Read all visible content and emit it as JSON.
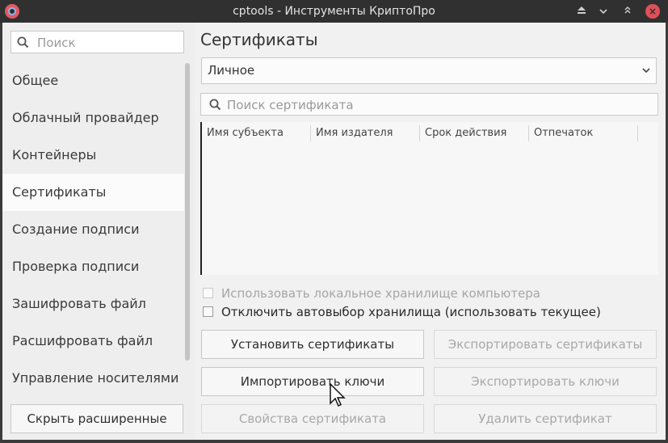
{
  "window": {
    "title": "cptools - Инструменты КриптоПро"
  },
  "sidebar": {
    "search_placeholder": "Поиск",
    "items": [
      {
        "label": "Общее"
      },
      {
        "label": "Облачный провайдер"
      },
      {
        "label": "Контейнеры"
      },
      {
        "label": "Сертификаты",
        "active": true
      },
      {
        "label": "Создание подписи"
      },
      {
        "label": "Проверка подписи"
      },
      {
        "label": "Зашифровать файл"
      },
      {
        "label": "Расшифровать файл"
      },
      {
        "label": "Управление носителями"
      }
    ],
    "hide_button": "Скрыть расширенные"
  },
  "main": {
    "heading": "Сертификаты",
    "store_select": {
      "value": "Личное"
    },
    "search_placeholder": "Поиск сертификата",
    "table": {
      "columns": [
        "Имя субъекта",
        "Имя издателя",
        "Срок действия",
        "Отпечаток"
      ],
      "rows": []
    },
    "options": {
      "use_local_store": {
        "label": "Использовать локальное хранилище компьютера",
        "checked": false,
        "enabled": false
      },
      "disable_autoselect": {
        "label": "Отключить автовыбор хранилища (использовать текущее)",
        "checked": false,
        "enabled": true
      }
    },
    "buttons": {
      "install_certs": {
        "label": "Установить сертификаты",
        "enabled": true
      },
      "export_certs": {
        "label": "Экспортировать сертификаты",
        "enabled": false
      },
      "import_keys": {
        "label": "Импортировать ключи",
        "enabled": true
      },
      "export_keys": {
        "label": "Экспортировать ключи",
        "enabled": false
      },
      "cert_properties": {
        "label": "Свойства сертификата",
        "enabled": false
      },
      "delete_cert": {
        "label": "Удалить сертификат",
        "enabled": false
      }
    }
  },
  "colors": {
    "titlebar": "#303030",
    "window_bg": "#f1f1f1",
    "close_button": "#e0505a",
    "active_item": "#fbfbfb"
  }
}
